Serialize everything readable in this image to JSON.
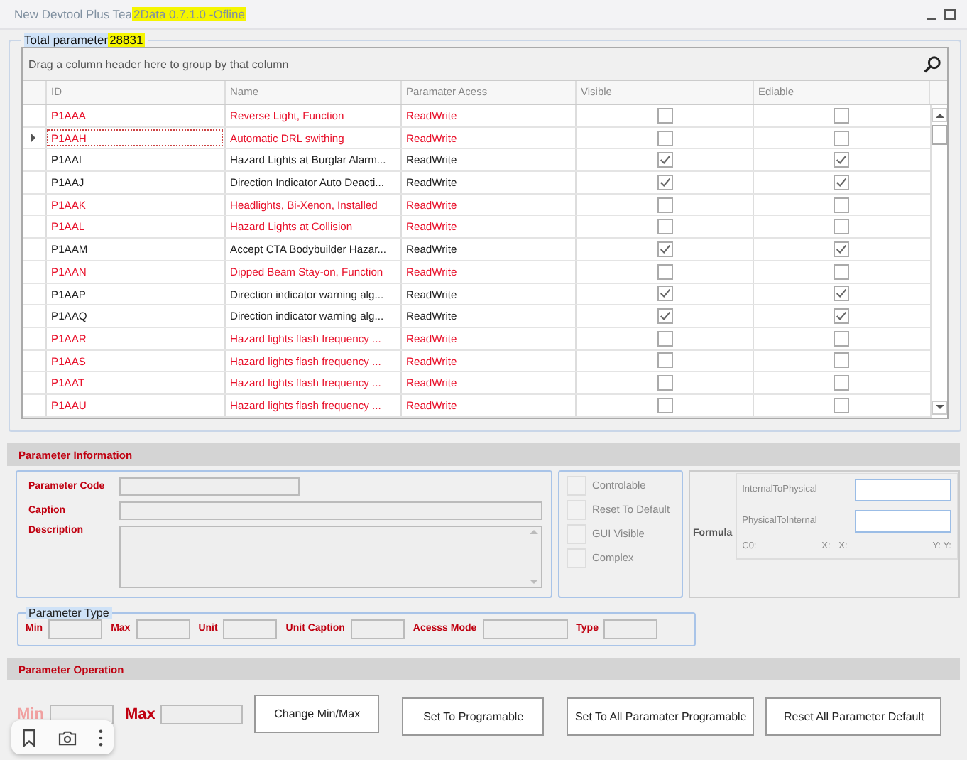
{
  "window": {
    "title_prefix": "New Devtool Plus Tea",
    "title_highlight": "2Data 0.7.1.0 -Ofline"
  },
  "parameters": {
    "label": "Total parameter",
    "count": "28831",
    "group_hint": "Drag a column header here to group by that column",
    "columns": [
      "ID",
      "Name",
      "Paramater Acess",
      "Visible",
      "Ediable"
    ],
    "rows": [
      {
        "id": "P1AAA",
        "name": "Reverse Light, Function",
        "access": "ReadWrite",
        "visible": false,
        "editable": false,
        "flagged": true,
        "selected": false
      },
      {
        "id": "P1AAH",
        "name": "Automatic DRL swithing",
        "access": "ReadWrite",
        "visible": false,
        "editable": false,
        "flagged": true,
        "selected": true
      },
      {
        "id": "P1AAI",
        "name": "Hazard Lights at Burglar Alarm...",
        "access": "ReadWrite",
        "visible": true,
        "editable": true,
        "flagged": false,
        "selected": false
      },
      {
        "id": "P1AAJ",
        "name": "Direction Indicator Auto Deacti...",
        "access": "ReadWrite",
        "visible": true,
        "editable": true,
        "flagged": false,
        "selected": false
      },
      {
        "id": "P1AAK",
        "name": "Headlights, Bi-Xenon, Installed",
        "access": "ReadWrite",
        "visible": false,
        "editable": false,
        "flagged": true,
        "selected": false
      },
      {
        "id": "P1AAL",
        "name": "Hazard Lights at Collision",
        "access": "ReadWrite",
        "visible": false,
        "editable": false,
        "flagged": true,
        "selected": false
      },
      {
        "id": "P1AAM",
        "name": "Accept CTA Bodybuilder Hazar...",
        "access": "ReadWrite",
        "visible": true,
        "editable": true,
        "flagged": false,
        "selected": false
      },
      {
        "id": "P1AAN",
        "name": "Dipped Beam Stay-on, Function",
        "access": "ReadWrite",
        "visible": false,
        "editable": false,
        "flagged": true,
        "selected": false
      },
      {
        "id": "P1AAP",
        "name": "Direction indicator warning alg...",
        "access": "ReadWrite",
        "visible": true,
        "editable": true,
        "flagged": false,
        "selected": false
      },
      {
        "id": "P1AAQ",
        "name": "Direction indicator warning alg...",
        "access": "ReadWrite",
        "visible": true,
        "editable": true,
        "flagged": false,
        "selected": false
      },
      {
        "id": "P1AAR",
        "name": "Hazard lights flash frequency ...",
        "access": "ReadWrite",
        "visible": false,
        "editable": false,
        "flagged": true,
        "selected": false
      },
      {
        "id": "P1AAS",
        "name": "Hazard lights flash frequency ...",
        "access": "ReadWrite",
        "visible": false,
        "editable": false,
        "flagged": true,
        "selected": false
      },
      {
        "id": "P1AAT",
        "name": "Hazard lights flash frequency ...",
        "access": "ReadWrite",
        "visible": false,
        "editable": false,
        "flagged": true,
        "selected": false
      },
      {
        "id": "P1AAU",
        "name": "Hazard lights flash frequency ...",
        "access": "ReadWrite",
        "visible": false,
        "editable": false,
        "flagged": true,
        "selected": false
      }
    ]
  },
  "info": {
    "title": "Parameter Information",
    "code_label": "Parameter Code",
    "caption_label": "Caption",
    "description_label": "Description",
    "options": [
      {
        "label": "Controlable",
        "checked": false
      },
      {
        "label": "Reset To Default",
        "checked": false
      },
      {
        "label": "GUI Visible",
        "checked": false
      },
      {
        "label": "Complex",
        "checked": false
      }
    ],
    "formula_label": "Formula",
    "internal_label": "InternalToPhysical",
    "physical_label": "PhysicalToInternal",
    "coef_labels": [
      "C0:",
      "X:",
      "X:",
      "Y: Y:"
    ]
  },
  "type": {
    "title": "Parameter Type",
    "fields": [
      "Min",
      "Max",
      "Unit",
      "Unit Caption",
      "Acesss Mode",
      "Type"
    ]
  },
  "operation": {
    "title": "Parameter  Operation",
    "min_label": "Min",
    "max_label": "Max",
    "buttons": [
      "Change Min/Max",
      "Set To Programable",
      "Set To All  Paramater Programable",
      "Reset All Parameter Default"
    ]
  }
}
